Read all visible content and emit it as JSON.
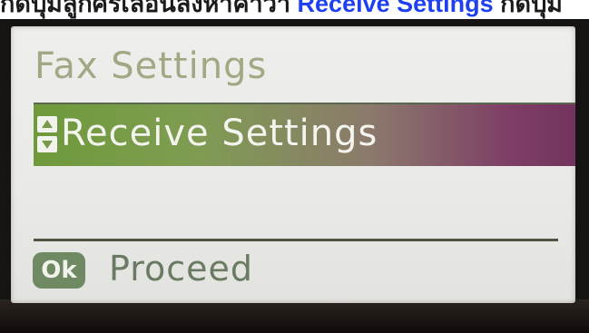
{
  "caption": {
    "prefix": "กดปุ่มลูกศรเลื่อนลงหาคำว่า ",
    "highlight": "Receive Settings",
    "suffix": " กดปุ่ม"
  },
  "lcd": {
    "title": "Fax Settings",
    "selected_item": {
      "label": "Receive Settings",
      "icon": "scroll-up-down-icon"
    },
    "footer": {
      "ok_badge": "Ok",
      "action_label": "Proceed"
    }
  },
  "colors": {
    "caption_highlight": "#1e40f0",
    "selection_start": "#6e9a3a",
    "selection_end": "#72345e",
    "title_text": "#a2a883",
    "footer_text": "#6b7a62",
    "ok_badge_bg": "#6f8a62",
    "bezel": "#161412"
  }
}
